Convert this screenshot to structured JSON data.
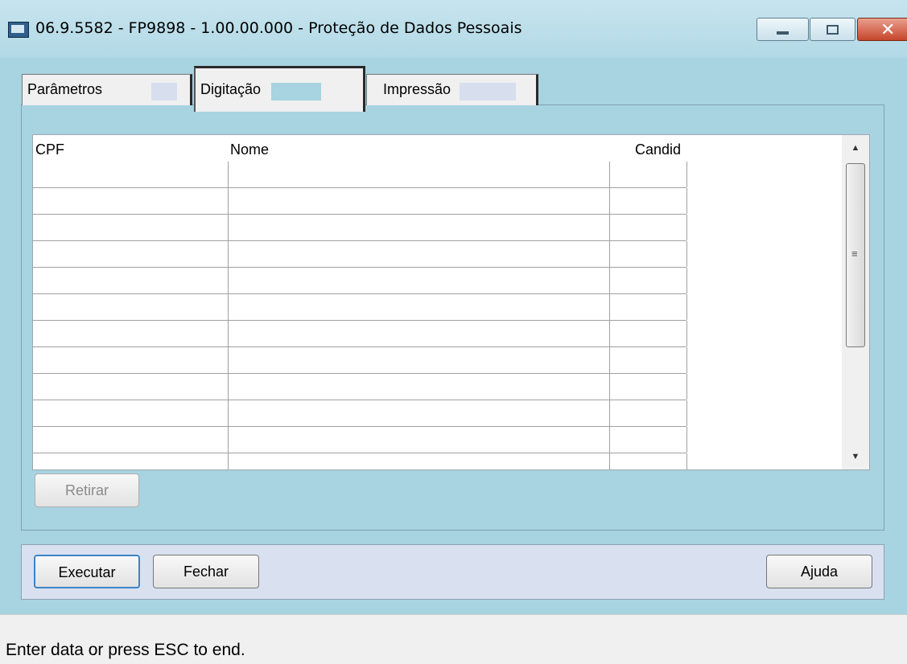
{
  "window": {
    "title": "06.9.5582 - FP9898 - 1.00.00.000 - Proteção de Dados Pessoais",
    "controls": {
      "minimize": "",
      "maximize": "",
      "close": "✕"
    }
  },
  "tabs": [
    {
      "label": "Parâmetros",
      "active": false
    },
    {
      "label": "Digitação",
      "active": true
    },
    {
      "label": "Impressão",
      "active": false
    }
  ],
  "grid": {
    "columns": [
      "CPF",
      "Nome",
      "Candid"
    ],
    "rows": [
      [
        "",
        "",
        ""
      ],
      [
        "",
        "",
        ""
      ],
      [
        "",
        "",
        ""
      ],
      [
        "",
        "",
        ""
      ],
      [
        "",
        "",
        ""
      ],
      [
        "",
        "",
        ""
      ],
      [
        "",
        "",
        ""
      ],
      [
        "",
        "",
        ""
      ],
      [
        "",
        "",
        ""
      ],
      [
        "",
        "",
        ""
      ],
      [
        "",
        "",
        ""
      ],
      [
        "",
        "",
        ""
      ]
    ]
  },
  "buttons": {
    "retirar": "Retirar",
    "executar": "Executar",
    "fechar": "Fechar",
    "ajuda": "Ajuda"
  },
  "status": "Enter data or press ESC to end."
}
